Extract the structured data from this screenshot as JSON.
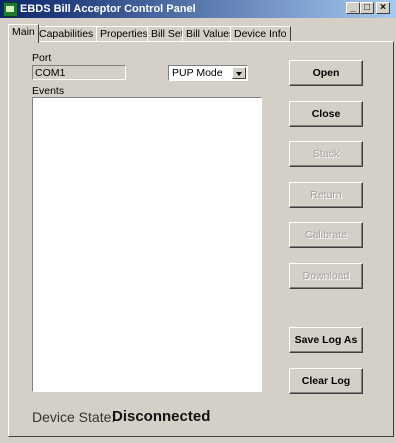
{
  "window": {
    "title": "EBDS Bill Acceptor Control Panel",
    "minimize_glyph": "_",
    "maximize_glyph": "□",
    "close_glyph": "×"
  },
  "tabs": [
    {
      "label": "Main",
      "active": true
    },
    {
      "label": "Capabilities",
      "active": false
    },
    {
      "label": "Properties",
      "active": false
    },
    {
      "label": "Bill Set",
      "active": false
    },
    {
      "label": "Bill Values",
      "active": false
    },
    {
      "label": "Device Info",
      "active": false
    }
  ],
  "main": {
    "port_label": "Port",
    "port_value": "COM1",
    "mode_value": "PUP Mode",
    "events_label": "Events",
    "events_items": []
  },
  "buttons": {
    "open": {
      "label": "Open",
      "enabled": true
    },
    "close": {
      "label": "Close",
      "enabled": true
    },
    "stack": {
      "label": "Stack",
      "enabled": false
    },
    "return": {
      "label": "Return",
      "enabled": false
    },
    "calibrate": {
      "label": "Calibrate",
      "enabled": false
    },
    "download": {
      "label": "Download",
      "enabled": false
    },
    "save_log_as": {
      "label": "Save Log As",
      "enabled": true
    },
    "clear_log": {
      "label": "Clear Log",
      "enabled": true
    }
  },
  "status": {
    "device_state_label": "Device State:",
    "device_state_value": "Disconnected"
  }
}
